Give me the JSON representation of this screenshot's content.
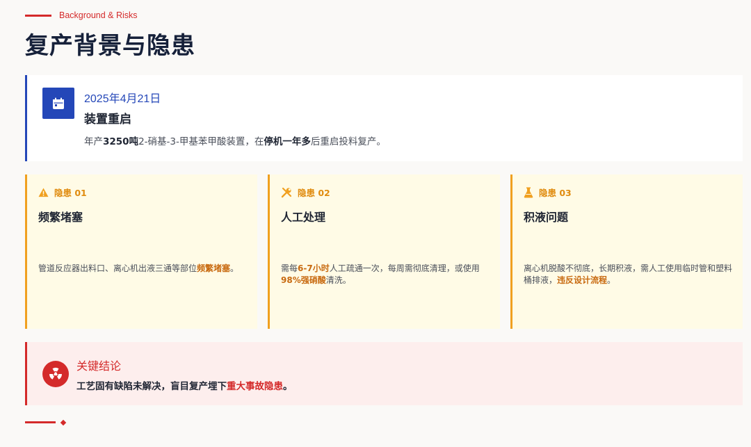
{
  "header": {
    "subtitle": "Background & Risks",
    "title": "复产背景与隐患"
  },
  "event": {
    "icon": "calendar-icon",
    "date": "2025年4月21日",
    "title": "装置重启",
    "desc_1": "年产",
    "desc_2": "3250吨",
    "desc_3": "2-硝基-3-甲基苯甲酸装置，在",
    "desc_4": "停机一年多",
    "desc_5": "后重启投料复产。"
  },
  "risks": [
    {
      "icon": "warning-triangle-icon",
      "label": "隐患 01",
      "title": "频繁堵塞",
      "text_1": "管道反应器出料口、离心机出液三通等部位",
      "text_hl_1": "频繁堵塞",
      "text_2": "。"
    },
    {
      "icon": "wrench-icon",
      "label": "隐患 02",
      "title": "人工处理",
      "text_1": "需每",
      "text_hl_1": "6-7小时",
      "text_2": "人工疏通一次，每周需彻底清理，或使用",
      "text_hl_2": "98%强硝酸",
      "text_3": "清洗。"
    },
    {
      "icon": "flask-icon",
      "label": "隐患 03",
      "title": "积液问题",
      "text_1": "离心机脱酸不彻底，长期积液，需人工使用临时管和塑料桶排液，",
      "text_hl_1": "违反设计流程",
      "text_2": "。"
    }
  ],
  "conclusion": {
    "icon": "radiation-icon",
    "title": "关键结论",
    "text_1": "工艺固有缺陷未解决，盲目复产埋下",
    "text_hl": "重大事故隐患",
    "text_2": "。"
  },
  "colors": {
    "accent_red": "#d42a2a",
    "accent_blue": "#2447b8",
    "warning_orange": "#f0a020",
    "highlight_orange": "#c86a10"
  }
}
